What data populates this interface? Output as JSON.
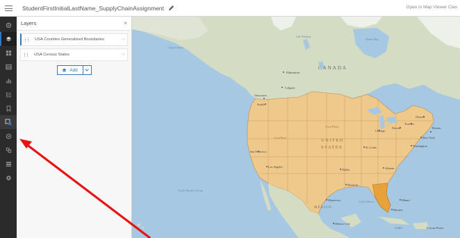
{
  "header": {
    "title": "StudentFirstInitialLastName_SupplyChainAssignment",
    "open_in_map_viewer": "Open in Map Viewer Clas"
  },
  "nav": {
    "items": [
      "settings-icon",
      "layers-icon",
      "basemap-icon",
      "charts-icon",
      "legend-icon",
      "bookmarks-icon",
      "tables-icon",
      "properties-icon",
      "filter-icon",
      "sketch-icon",
      "analysis-icon",
      "config-icon",
      "share-icon"
    ]
  },
  "panel": {
    "title": "Layers",
    "close": "×",
    "layers": [
      {
        "name": "USA Counties Generalized Boundaries",
        "more": "···"
      },
      {
        "name": "USA Census States",
        "more": "···"
      }
    ],
    "add_label": "Add"
  },
  "map": {
    "labels": {
      "canada": "CANADA",
      "edmonton": "Edmonton",
      "calgary": "Calgary",
      "vancouver": "Vancouver",
      "seattle": "Seattle",
      "united": "UNITED",
      "states": "STATES",
      "chicago": "Chicago",
      "detroit": "Detroit",
      "toronto": "Toronto",
      "ottawa": "Ottawa",
      "boston": "Boston",
      "new_york": "New York",
      "washington": "Washington",
      "st_louis": "St. Louis",
      "atlanta": "Atlanta",
      "dallas": "Dallas",
      "houston": "Houston",
      "san_francisco": "San Francisco",
      "los_angeles": "Los Angeles",
      "monterrey": "Monterrey",
      "mexico": "MÉXICO",
      "mexico_city": "Mexico City",
      "havana": "Havana",
      "miami": "Miami",
      "cuba": "CUBA",
      "port_au_prince": "Port-au-Prince",
      "hudson_bay": "Hudson Bay",
      "gulf_of_alaska": "Gulf of Alaska",
      "north_pacific_ocean": "North Pacific Ocean",
      "gulf_of_mexico": "Gulf of Mexico",
      "lake_winnipeg": "Lake Winnipeg",
      "great_plains": "Great Plains",
      "great_basin": "Great Basin"
    }
  },
  "colors": {
    "accent": "#2f79c3",
    "states_fill": "#efc98c",
    "florida_fill": "#e8a23a",
    "ocean": "#a7c8e3",
    "land_green": "#d4dcc4",
    "arrow": "#e81212"
  }
}
